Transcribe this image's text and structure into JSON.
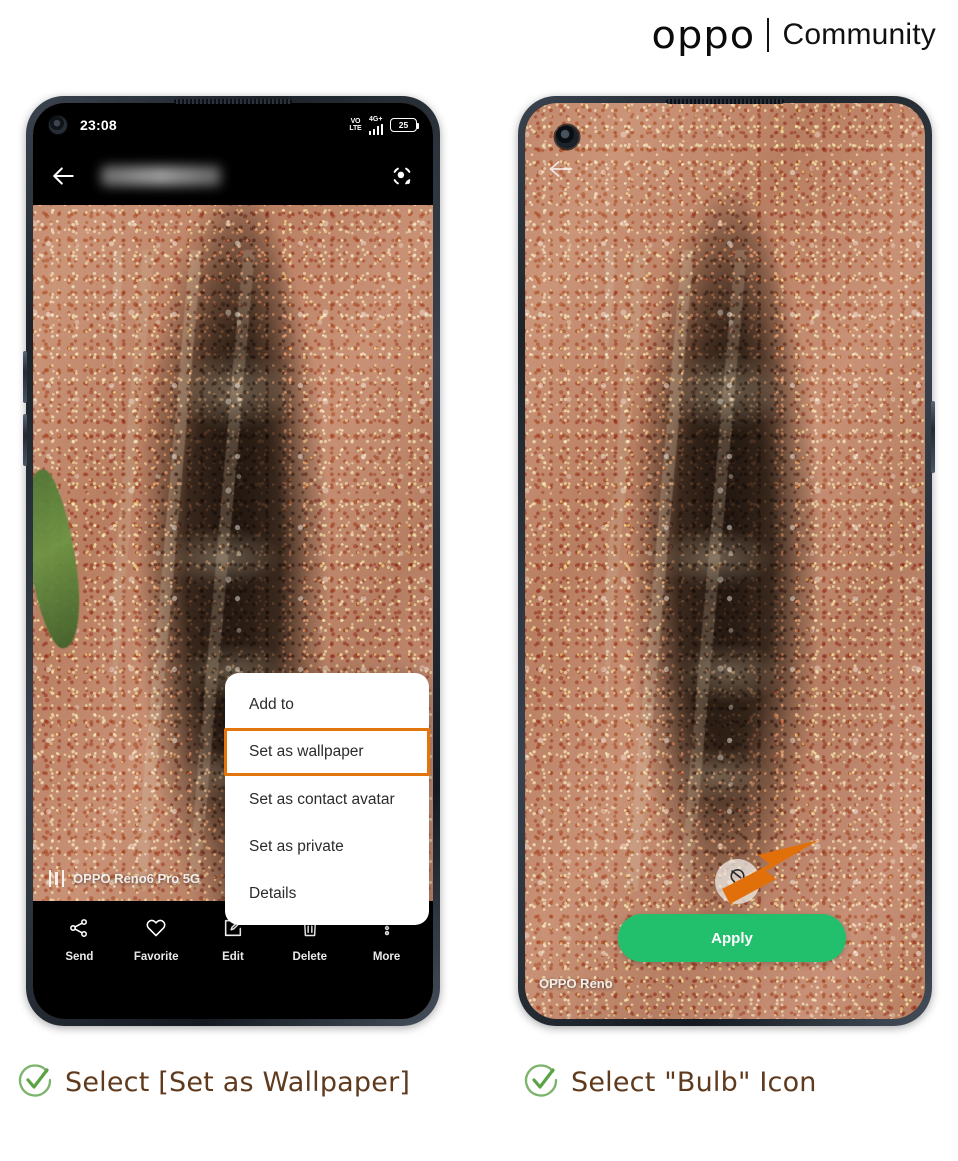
{
  "brand": {
    "oppo": "oppo",
    "community": "Community"
  },
  "colors": {
    "highlight_orange": "#e2760d",
    "arrow_orange": "#e2700a",
    "apply_green": "#22c06c",
    "check_green": "#6aab5e",
    "caption_brown": "#5f3a1d",
    "soil": "#c89178"
  },
  "phone_left": {
    "status_bar": {
      "time": "23:08",
      "network_label": "4G+",
      "volte_label": "VO\nLTE",
      "battery_percent": "25"
    },
    "app_bar": {
      "back_icon": "arrow-left-icon",
      "title": "",
      "lens_icon": "scan-lens-icon"
    },
    "watermark": "OPPO Reno6 Pro 5G",
    "context_menu": {
      "items": [
        {
          "label": "Add to",
          "highlighted": false
        },
        {
          "label": "Set as wallpaper",
          "highlighted": true
        },
        {
          "label": "Set as contact avatar",
          "highlighted": false
        },
        {
          "label": "Set as private",
          "highlighted": false
        },
        {
          "label": "Details",
          "highlighted": false
        }
      ]
    },
    "toolbar": [
      {
        "label": "Send",
        "icon": "share-icon"
      },
      {
        "label": "Favorite",
        "icon": "heart-icon"
      },
      {
        "label": "Edit",
        "icon": "edit-pencil-icon"
      },
      {
        "label": "Delete",
        "icon": "trash-icon"
      },
      {
        "label": "More",
        "icon": "more-vertical-icon"
      }
    ]
  },
  "phone_right": {
    "back_icon": "arrow-left-icon",
    "bulb_icon": "bulb-icon",
    "apply_label": "Apply",
    "watermark": "OPPO Reno"
  },
  "captions": {
    "left": "Select [Set as Wallpaper]",
    "right": "Select \"Bulb\" Icon"
  }
}
